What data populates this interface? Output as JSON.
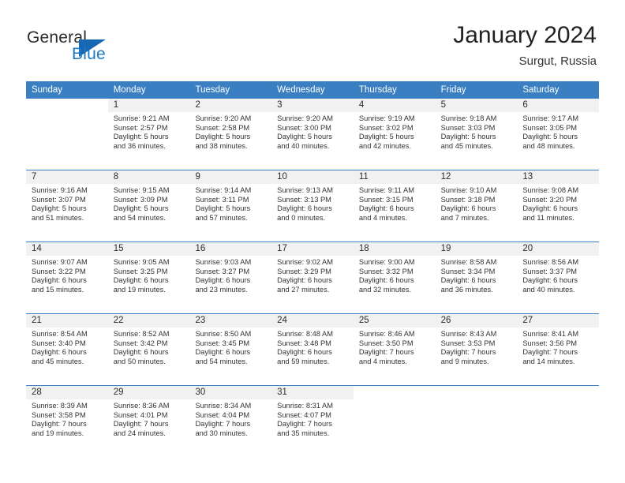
{
  "brand": {
    "name_part1": "General",
    "name_part2": "Blue"
  },
  "header": {
    "title": "January 2024",
    "subtitle": "Surgut, Russia"
  },
  "colors": {
    "header_blue": "#3a7fc1",
    "logo_blue": "#1668b3",
    "day_band_gray": "#f1f1f1"
  },
  "weekday_headers": [
    "Sunday",
    "Monday",
    "Tuesday",
    "Wednesday",
    "Thursday",
    "Friday",
    "Saturday"
  ],
  "weeks": [
    [
      {
        "day": "",
        "sunrise": "",
        "sunset": "",
        "daylight1": "",
        "daylight2": "",
        "blank": true
      },
      {
        "day": "1",
        "sunrise": "Sunrise: 9:21 AM",
        "sunset": "Sunset: 2:57 PM",
        "daylight1": "Daylight: 5 hours",
        "daylight2": "and 36 minutes."
      },
      {
        "day": "2",
        "sunrise": "Sunrise: 9:20 AM",
        "sunset": "Sunset: 2:58 PM",
        "daylight1": "Daylight: 5 hours",
        "daylight2": "and 38 minutes."
      },
      {
        "day": "3",
        "sunrise": "Sunrise: 9:20 AM",
        "sunset": "Sunset: 3:00 PM",
        "daylight1": "Daylight: 5 hours",
        "daylight2": "and 40 minutes."
      },
      {
        "day": "4",
        "sunrise": "Sunrise: 9:19 AM",
        "sunset": "Sunset: 3:02 PM",
        "daylight1": "Daylight: 5 hours",
        "daylight2": "and 42 minutes."
      },
      {
        "day": "5",
        "sunrise": "Sunrise: 9:18 AM",
        "sunset": "Sunset: 3:03 PM",
        "daylight1": "Daylight: 5 hours",
        "daylight2": "and 45 minutes."
      },
      {
        "day": "6",
        "sunrise": "Sunrise: 9:17 AM",
        "sunset": "Sunset: 3:05 PM",
        "daylight1": "Daylight: 5 hours",
        "daylight2": "and 48 minutes."
      }
    ],
    [
      {
        "day": "7",
        "sunrise": "Sunrise: 9:16 AM",
        "sunset": "Sunset: 3:07 PM",
        "daylight1": "Daylight: 5 hours",
        "daylight2": "and 51 minutes."
      },
      {
        "day": "8",
        "sunrise": "Sunrise: 9:15 AM",
        "sunset": "Sunset: 3:09 PM",
        "daylight1": "Daylight: 5 hours",
        "daylight2": "and 54 minutes."
      },
      {
        "day": "9",
        "sunrise": "Sunrise: 9:14 AM",
        "sunset": "Sunset: 3:11 PM",
        "daylight1": "Daylight: 5 hours",
        "daylight2": "and 57 minutes."
      },
      {
        "day": "10",
        "sunrise": "Sunrise: 9:13 AM",
        "sunset": "Sunset: 3:13 PM",
        "daylight1": "Daylight: 6 hours",
        "daylight2": "and 0 minutes."
      },
      {
        "day": "11",
        "sunrise": "Sunrise: 9:11 AM",
        "sunset": "Sunset: 3:15 PM",
        "daylight1": "Daylight: 6 hours",
        "daylight2": "and 4 minutes."
      },
      {
        "day": "12",
        "sunrise": "Sunrise: 9:10 AM",
        "sunset": "Sunset: 3:18 PM",
        "daylight1": "Daylight: 6 hours",
        "daylight2": "and 7 minutes."
      },
      {
        "day": "13",
        "sunrise": "Sunrise: 9:08 AM",
        "sunset": "Sunset: 3:20 PM",
        "daylight1": "Daylight: 6 hours",
        "daylight2": "and 11 minutes."
      }
    ],
    [
      {
        "day": "14",
        "sunrise": "Sunrise: 9:07 AM",
        "sunset": "Sunset: 3:22 PM",
        "daylight1": "Daylight: 6 hours",
        "daylight2": "and 15 minutes."
      },
      {
        "day": "15",
        "sunrise": "Sunrise: 9:05 AM",
        "sunset": "Sunset: 3:25 PM",
        "daylight1": "Daylight: 6 hours",
        "daylight2": "and 19 minutes."
      },
      {
        "day": "16",
        "sunrise": "Sunrise: 9:03 AM",
        "sunset": "Sunset: 3:27 PM",
        "daylight1": "Daylight: 6 hours",
        "daylight2": "and 23 minutes."
      },
      {
        "day": "17",
        "sunrise": "Sunrise: 9:02 AM",
        "sunset": "Sunset: 3:29 PM",
        "daylight1": "Daylight: 6 hours",
        "daylight2": "and 27 minutes."
      },
      {
        "day": "18",
        "sunrise": "Sunrise: 9:00 AM",
        "sunset": "Sunset: 3:32 PM",
        "daylight1": "Daylight: 6 hours",
        "daylight2": "and 32 minutes."
      },
      {
        "day": "19",
        "sunrise": "Sunrise: 8:58 AM",
        "sunset": "Sunset: 3:34 PM",
        "daylight1": "Daylight: 6 hours",
        "daylight2": "and 36 minutes."
      },
      {
        "day": "20",
        "sunrise": "Sunrise: 8:56 AM",
        "sunset": "Sunset: 3:37 PM",
        "daylight1": "Daylight: 6 hours",
        "daylight2": "and 40 minutes."
      }
    ],
    [
      {
        "day": "21",
        "sunrise": "Sunrise: 8:54 AM",
        "sunset": "Sunset: 3:40 PM",
        "daylight1": "Daylight: 6 hours",
        "daylight2": "and 45 minutes."
      },
      {
        "day": "22",
        "sunrise": "Sunrise: 8:52 AM",
        "sunset": "Sunset: 3:42 PM",
        "daylight1": "Daylight: 6 hours",
        "daylight2": "and 50 minutes."
      },
      {
        "day": "23",
        "sunrise": "Sunrise: 8:50 AM",
        "sunset": "Sunset: 3:45 PM",
        "daylight1": "Daylight: 6 hours",
        "daylight2": "and 54 minutes."
      },
      {
        "day": "24",
        "sunrise": "Sunrise: 8:48 AM",
        "sunset": "Sunset: 3:48 PM",
        "daylight1": "Daylight: 6 hours",
        "daylight2": "and 59 minutes."
      },
      {
        "day": "25",
        "sunrise": "Sunrise: 8:46 AM",
        "sunset": "Sunset: 3:50 PM",
        "daylight1": "Daylight: 7 hours",
        "daylight2": "and 4 minutes."
      },
      {
        "day": "26",
        "sunrise": "Sunrise: 8:43 AM",
        "sunset": "Sunset: 3:53 PM",
        "daylight1": "Daylight: 7 hours",
        "daylight2": "and 9 minutes."
      },
      {
        "day": "27",
        "sunrise": "Sunrise: 8:41 AM",
        "sunset": "Sunset: 3:56 PM",
        "daylight1": "Daylight: 7 hours",
        "daylight2": "and 14 minutes."
      }
    ],
    [
      {
        "day": "28",
        "sunrise": "Sunrise: 8:39 AM",
        "sunset": "Sunset: 3:58 PM",
        "daylight1": "Daylight: 7 hours",
        "daylight2": "and 19 minutes."
      },
      {
        "day": "29",
        "sunrise": "Sunrise: 8:36 AM",
        "sunset": "Sunset: 4:01 PM",
        "daylight1": "Daylight: 7 hours",
        "daylight2": "and 24 minutes."
      },
      {
        "day": "30",
        "sunrise": "Sunrise: 8:34 AM",
        "sunset": "Sunset: 4:04 PM",
        "daylight1": "Daylight: 7 hours",
        "daylight2": "and 30 minutes."
      },
      {
        "day": "31",
        "sunrise": "Sunrise: 8:31 AM",
        "sunset": "Sunset: 4:07 PM",
        "daylight1": "Daylight: 7 hours",
        "daylight2": "and 35 minutes."
      },
      {
        "day": "",
        "sunrise": "",
        "sunset": "",
        "daylight1": "",
        "daylight2": "",
        "blank": true
      },
      {
        "day": "",
        "sunrise": "",
        "sunset": "",
        "daylight1": "",
        "daylight2": "",
        "blank": true
      },
      {
        "day": "",
        "sunrise": "",
        "sunset": "",
        "daylight1": "",
        "daylight2": "",
        "blank": true
      }
    ]
  ]
}
